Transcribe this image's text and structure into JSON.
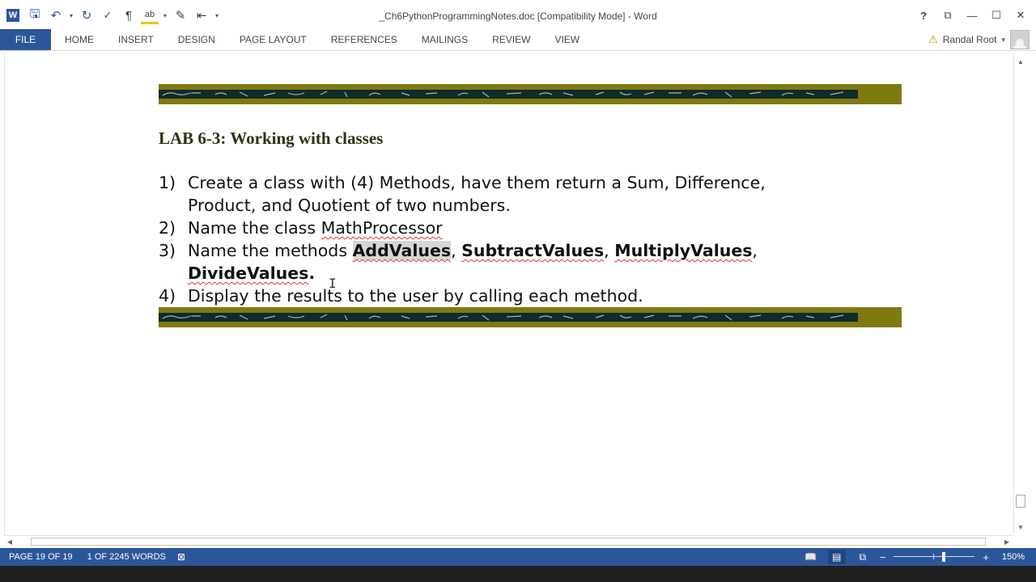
{
  "window": {
    "title": "_Ch6PythonProgrammingNotes.doc [Compatibility Mode] - Word"
  },
  "quick_access": [
    {
      "icon": "word-logo-icon",
      "glyph": "W"
    },
    {
      "icon": "save-icon",
      "glyph": "🖫"
    },
    {
      "icon": "undo-icon",
      "glyph": "↶"
    },
    {
      "icon": "redo-icon",
      "glyph": "↻"
    },
    {
      "icon": "spelling-grammar-icon",
      "glyph": "✓"
    },
    {
      "icon": "show-formatting-icon",
      "glyph": "¶"
    },
    {
      "icon": "spelling-check-icon",
      "glyph": "ab"
    },
    {
      "icon": "format-painter-icon",
      "glyph": "✎"
    },
    {
      "icon": "page-width-icon",
      "glyph": "⇤"
    }
  ],
  "window_controls": {
    "help": "?",
    "ribbon_display": "⧉",
    "minimize": "—",
    "maximize": "☐",
    "close": "✕"
  },
  "ribbon": {
    "tabs": [
      "FILE",
      "HOME",
      "INSERT",
      "DESIGN",
      "PAGE LAYOUT",
      "REFERENCES",
      "MAILINGS",
      "REVIEW",
      "VIEW"
    ]
  },
  "user": {
    "name": "Randal Root",
    "warning_glyph": "⚠",
    "dropdown_glyph": "▾"
  },
  "document": {
    "lab_title": "LAB 6-3: Working with classes",
    "items": [
      {
        "num": "1)",
        "text": "Create a class with (4) Methods, have them return a Sum, Difference, Product, and Quotient of two numbers."
      },
      {
        "num": "2)",
        "prefix": "Name the class ",
        "class_name": "MathProcessor"
      },
      {
        "num": "3)",
        "prefix": "Name the methods ",
        "methods": [
          "AddValues",
          "SubtractValues",
          "MultiplyValues",
          "DivideValues"
        ],
        "sep": ", ",
        "end": "."
      },
      {
        "num": "4)",
        "text": "Display the results to the user by calling each method."
      }
    ],
    "cursor_glyph": "I"
  },
  "status_bar": {
    "page": "PAGE 19 OF 19",
    "words": "1 OF 2245 WORDS",
    "proofing_glyph": "⊠",
    "zoom_label": "150%",
    "zoom_minus": "−",
    "zoom_plus": "+",
    "zoom_level_fraction": 0.62,
    "view_icons": [
      {
        "name": "read-mode-icon",
        "glyph": "📖"
      },
      {
        "name": "print-layout-icon",
        "glyph": "▤"
      },
      {
        "name": "web-layout-icon",
        "glyph": "⧉"
      }
    ]
  },
  "colors": {
    "word_blue": "#2b579a",
    "banner_olive": "#7f7a10",
    "banner_strip": "#0f2b2b",
    "title_green": "#2f3310"
  }
}
